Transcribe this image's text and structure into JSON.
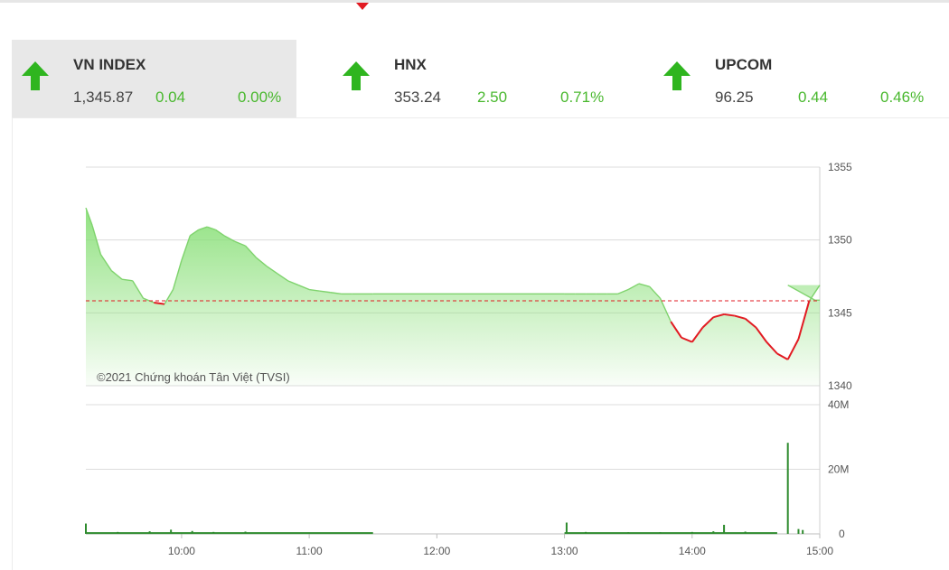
{
  "indices": [
    {
      "name": "VN INDEX",
      "value": "1,345.87",
      "change": "0.04",
      "percent": "0.00%",
      "direction": "up",
      "active": true
    },
    {
      "name": "HNX",
      "value": "353.24",
      "change": "2.50",
      "percent": "0.71%",
      "direction": "up",
      "active": false
    },
    {
      "name": "UPCOM",
      "value": "96.25",
      "change": "0.44",
      "percent": "0.46%",
      "direction": "up",
      "active": false
    }
  ],
  "colors": {
    "up": "#2fb51f",
    "down": "#e21a22",
    "area": "#8be07a",
    "volume": "#2e8b2e"
  },
  "chart_data": [
    {
      "type": "area",
      "annotation": "©2021 Chứng khoán Tân Việt (TVSI)",
      "x": [
        "09:15",
        "09:18",
        "09:22",
        "09:27",
        "09:32",
        "09:37",
        "09:42",
        "09:47",
        "09:52",
        "09:56",
        "10:00",
        "10:04",
        "10:08",
        "10:12",
        "10:16",
        "10:20",
        "10:25",
        "10:30",
        "10:35",
        "10:40",
        "10:45",
        "10:50",
        "10:55",
        "11:00",
        "11:05",
        "11:10",
        "11:15",
        "11:20",
        "11:25",
        "11:30",
        "13:00",
        "13:05",
        "13:10",
        "13:15",
        "13:20",
        "13:25",
        "13:30",
        "13:35",
        "13:40",
        "13:45",
        "13:50",
        "13:55",
        "14:00",
        "14:05",
        "14:10",
        "14:15",
        "14:20",
        "14:25",
        "14:30",
        "14:35",
        "14:40",
        "14:45",
        "14:50",
        "14:55",
        "15:00"
      ],
      "y": [
        1352.2,
        1351.0,
        1349.0,
        1347.9,
        1347.3,
        1347.2,
        1346.0,
        1345.7,
        1345.6,
        1346.6,
        1348.6,
        1350.3,
        1350.7,
        1350.9,
        1350.7,
        1350.3,
        1349.9,
        1349.6,
        1348.8,
        1348.2,
        1347.7,
        1347.2,
        1346.9,
        1346.6,
        1346.5,
        1346.4,
        1346.3,
        1346.3,
        1346.3,
        1346.3,
        1346.3,
        1346.3,
        1346.3,
        1346.3,
        1346.3,
        1346.3,
        1346.6,
        1347.0,
        1346.8,
        1346.0,
        1344.4,
        1343.3,
        1343.0,
        1344.0,
        1344.7,
        1344.9,
        1344.8,
        1344.6,
        1344.0,
        1343.0,
        1342.2,
        1341.8,
        1343.2,
        1345.8,
        1346.9
      ],
      "reference": 1345.83,
      "ylim": [
        1340,
        1355
      ],
      "y_ticks": [
        1340,
        1345,
        1350,
        1355
      ],
      "x_ticks": [
        "10:00",
        "11:00",
        "12:00",
        "13:00",
        "14:00",
        "15:00"
      ],
      "gap": {
        "from": "11:30",
        "to": "13:00"
      },
      "close_extension": {
        "time": "14:45",
        "value": 1346.9,
        "end_value": 1345.87
      }
    },
    {
      "type": "bar",
      "series": [
        {
          "values": [
            {
              "x": "09:15",
              "y": 3.2
            },
            {
              "x": "09:30",
              "y": 0.6
            },
            {
              "x": "09:45",
              "y": 0.8
            },
            {
              "x": "09:55",
              "y": 1.3
            },
            {
              "x": "10:05",
              "y": 0.9
            },
            {
              "x": "10:15",
              "y": 0.6
            },
            {
              "x": "10:30",
              "y": 0.7
            },
            {
              "x": "10:45",
              "y": 0.4
            },
            {
              "x": "11:00",
              "y": 0.4
            },
            {
              "x": "11:15",
              "y": 0.3
            },
            {
              "x": "11:29",
              "y": 0.3
            },
            {
              "x": "13:01",
              "y": 3.5
            },
            {
              "x": "13:10",
              "y": 0.6
            },
            {
              "x": "13:30",
              "y": 0.5
            },
            {
              "x": "13:45",
              "y": 0.5
            },
            {
              "x": "14:00",
              "y": 0.6
            },
            {
              "x": "14:10",
              "y": 0.8
            },
            {
              "x": "14:15",
              "y": 2.8
            },
            {
              "x": "14:25",
              "y": 0.7
            },
            {
              "x": "14:45",
              "y": 28.2
            },
            {
              "x": "14:50",
              "y": 1.5
            },
            {
              "x": "14:52",
              "y": 1.2
            }
          ]
        }
      ],
      "ylim": [
        0,
        40
      ],
      "y_ticks": [
        "0",
        "20M",
        "40M"
      ],
      "x_ticks": [
        "10:00",
        "11:00",
        "12:00",
        "13:00",
        "14:00",
        "15:00"
      ]
    }
  ]
}
